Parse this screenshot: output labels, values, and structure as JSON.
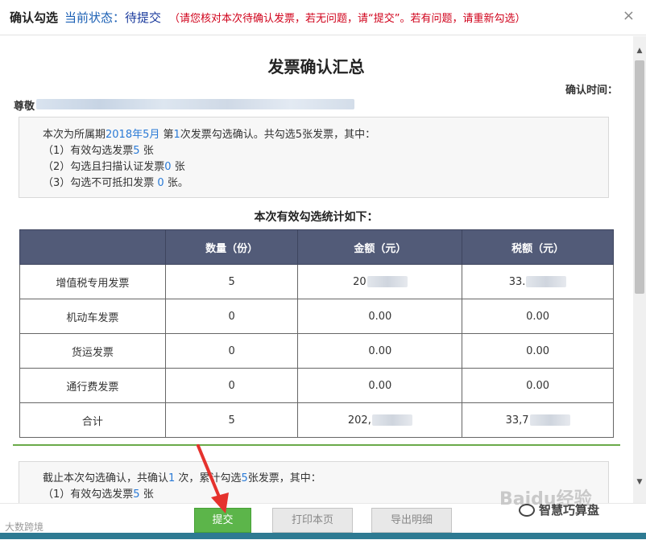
{
  "titlebar": {
    "title": "确认勾选",
    "status_label": "当前状态：",
    "status_value": "待提交",
    "note": "（请您核对本次待确认发票，若无问题，请“提交”。若有问题，请重新勾选）",
    "close_icon": "×"
  },
  "document": {
    "title": "发票确认汇总",
    "confirm_time_label": "确认时间：",
    "dear_label": "尊敬"
  },
  "summary": {
    "p1_a": "本次为所属期",
    "p1_period": "2018年5月",
    "p1_b": " 第",
    "p1_count": "1",
    "p1_c": "次发票勾选确认。共勾选5张发票，其中：",
    "l1_a": "（1）有效勾选发票",
    "l1_num": "5",
    "l1_b": " 张",
    "l2_a": "（2）勾选且扫描认证发票",
    "l2_num": "0",
    "l2_b": " 张",
    "l3_a": "（3）勾选不可抵扣发票 ",
    "l3_num": "0",
    "l3_b": " 张。"
  },
  "stats": {
    "title": "本次有效勾选统计如下：",
    "columns": [
      "",
      "数量（份）",
      "金额（元）",
      "税额（元）"
    ],
    "rows": [
      {
        "type": "增值税专用发票",
        "count": "5",
        "amount": "20",
        "tax": "33."
      },
      {
        "type": "机动车发票",
        "count": "0",
        "amount": "0.00",
        "tax": "0.00"
      },
      {
        "type": "货运发票",
        "count": "0",
        "amount": "0.00",
        "tax": "0.00"
      },
      {
        "type": "通行费发票",
        "count": "0",
        "amount": "0.00",
        "tax": "0.00"
      },
      {
        "type": "合计",
        "count": "5",
        "amount": "202,",
        "tax": "33,7"
      }
    ]
  },
  "summary2": {
    "a": "截止本次勾选确认，共确认",
    "times": "1",
    "b": " 次，累计勾选",
    "total": "5",
    "c": "张发票，其中：",
    "l1_a": "（1）有效勾选发票",
    "l1_num": "5",
    "l1_b": " 张"
  },
  "footer": {
    "submit": "提交",
    "print": "打印本页",
    "export": "导出明细"
  },
  "watermarks": {
    "left": "大数跨境",
    "right": "Baidu经验",
    "wechat": "智慧巧算盘"
  },
  "colors": {
    "accent_green": "#5cb54a",
    "header_table": "#525b78",
    "status_red": "#d0021b",
    "link_blue": "#2a7ad6"
  }
}
